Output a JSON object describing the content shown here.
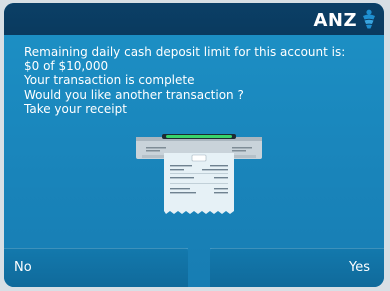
{
  "brand": {
    "name": "ANZ",
    "logo_icon": "anz-figure-icon",
    "colors": {
      "topbar": "#0b3f66",
      "screen": "#1a87bd",
      "button": "#106a9b",
      "logo_mark": "#1e8fd0"
    }
  },
  "message": {
    "line1": "Remaining daily cash deposit limit for this account is:",
    "line2": "$0 of $10,000",
    "line3": "Your transaction is complete",
    "line4": "Would you like another transaction ?",
    "line5": "Take your receipt"
  },
  "illustration": {
    "icon": "receipt-printer-icon"
  },
  "buttons": {
    "no_label": "No",
    "yes_label": "Yes"
  }
}
